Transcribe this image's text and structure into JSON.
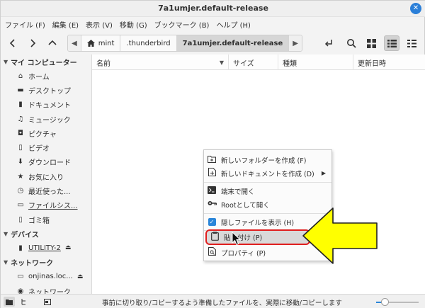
{
  "window": {
    "title": "7a1umjer.default-release",
    "close_glyph": "✕"
  },
  "menubar": [
    {
      "name": "menu-file",
      "label": "ファイル (F)"
    },
    {
      "name": "menu-edit",
      "label": "編集 (E)"
    },
    {
      "name": "menu-view",
      "label": "表示 (V)"
    },
    {
      "name": "menu-go",
      "label": "移動 (G)"
    },
    {
      "name": "menu-bookmarks",
      "label": "ブックマーク (B)"
    },
    {
      "name": "menu-help",
      "label": "ヘルプ (H)"
    }
  ],
  "toolbar": {
    "path": [
      {
        "name": "crumb-home",
        "label": "mint",
        "icon": "home-icon"
      },
      {
        "name": "crumb-thunderbird",
        "label": ".thunderbird"
      },
      {
        "name": "crumb-current",
        "label": "7a1umjer.default-release"
      }
    ]
  },
  "sidebar": {
    "sections": [
      {
        "name": "my-computer",
        "title": "マイ コンピューター",
        "items": [
          {
            "name": "home",
            "label": "ホーム",
            "icon": "home-icon"
          },
          {
            "name": "desktop",
            "label": "デスクトップ",
            "icon": "desktop-icon"
          },
          {
            "name": "documents",
            "label": "ドキュメント",
            "icon": "document-icon"
          },
          {
            "name": "music",
            "label": "ミュージック",
            "icon": "music-icon"
          },
          {
            "name": "pictures",
            "label": "ピクチャ",
            "icon": "camera-icon"
          },
          {
            "name": "videos",
            "label": "ビデオ",
            "icon": "film-icon"
          },
          {
            "name": "downloads",
            "label": "ダウンロード",
            "icon": "download-icon"
          },
          {
            "name": "favorites",
            "label": "お気に入り",
            "icon": "star-icon"
          },
          {
            "name": "recent",
            "label": "最近使った...",
            "icon": "clock-icon"
          },
          {
            "name": "filesystem",
            "label": "ファイルシス...",
            "icon": "drive-icon",
            "underline": true
          },
          {
            "name": "trash",
            "label": "ゴミ箱",
            "icon": "trash-icon"
          }
        ]
      },
      {
        "name": "devices",
        "title": "デバイス",
        "items": [
          {
            "name": "utility-2",
            "label": "UTILITY-2",
            "icon": "usb-icon",
            "underline": true,
            "eject": true
          }
        ]
      },
      {
        "name": "network",
        "title": "ネットワーク",
        "items": [
          {
            "name": "onjinas",
            "label": "onjinas.loc...",
            "icon": "network-share-icon",
            "eject": true
          },
          {
            "name": "network",
            "label": "ネットワーク",
            "icon": "network-icon"
          }
        ]
      }
    ]
  },
  "columns": {
    "name": "名前",
    "size": "サイズ",
    "type": "種類",
    "modified": "更新日時"
  },
  "context_menu": {
    "items": [
      {
        "name": "create-folder",
        "label": "新しいフォルダーを作成 (F)",
        "icon": "folder-plus-icon"
      },
      {
        "name": "create-document",
        "label": "新しいドキュメントを作成 (D)",
        "icon": "document-plus-icon",
        "submenu": true
      },
      {
        "name": "open-terminal",
        "label": "端末で開く",
        "icon": "terminal-icon"
      },
      {
        "name": "open-as-root",
        "label": "Rootとして開く",
        "icon": "key-icon"
      },
      {
        "name": "show-hidden",
        "label": "隠しファイルを表示 (H)",
        "icon": "checkbox-checked-icon"
      },
      {
        "name": "paste",
        "label": "貼り付け (P)",
        "icon": "clipboard-icon",
        "highlighted": true
      },
      {
        "name": "properties",
        "label": "プロパティ (P)",
        "icon": "properties-icon"
      }
    ]
  },
  "statusbar": {
    "message": "事前に切り取り/コピーするよう準備したファイルを、実際に移動/コピーします",
    "zoom_fraction": 0.2
  },
  "colors": {
    "accent": "#2b86d9",
    "highlight_border": "#e01e1e",
    "annotation_arrow_fill": "#ffff00"
  }
}
